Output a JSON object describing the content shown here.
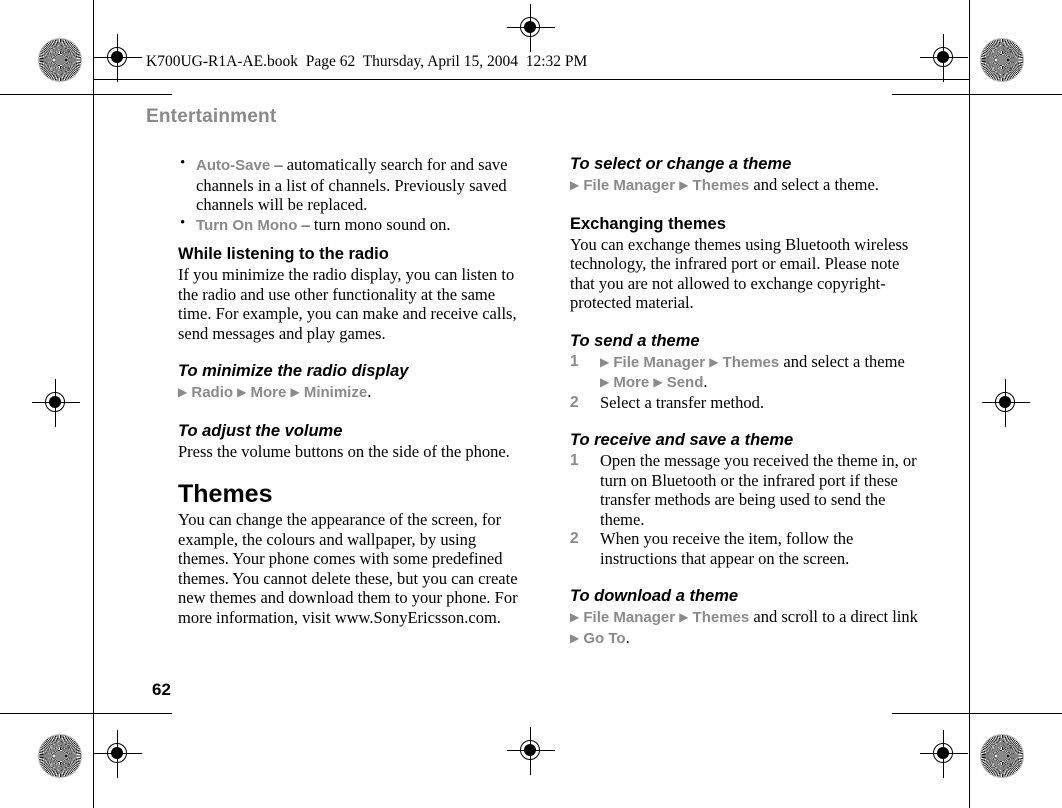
{
  "print_marks": {
    "file_header": "K700UG-R1A-AE.book  Page 62  Thursday, April 15, 2004  12:32 PM"
  },
  "page": {
    "running_head": "Entertainment",
    "page_number": "62",
    "arrow_glyph": "▶",
    "bullet_glyph": "•"
  },
  "left_column": {
    "bullets": [
      {
        "term": "Auto-Save",
        "dash": " – ",
        "text": "automatically search for and save channels in a list of channels. Previously saved channels will be replaced."
      },
      {
        "term": "Turn On Mono",
        "dash": " – ",
        "text": "turn mono sound on."
      }
    ],
    "section_listening": {
      "heading": "While listening to the radio",
      "body": "If you minimize the radio display, you can listen to the radio and use other functionality at the same time. For example, you can make and receive calls, send messages and play games."
    },
    "section_minimize": {
      "heading": "To minimize the radio display",
      "nav": [
        "Radio",
        "More",
        "Minimize"
      ],
      "nav_suffix": "."
    },
    "section_volume": {
      "heading": "To adjust the volume",
      "body": "Press the volume buttons on the side of the phone."
    },
    "section_themes": {
      "heading": "Themes",
      "body": "You can change the appearance of the screen, for example, the colours and wallpaper, by using themes. Your phone comes with some predefined themes. You cannot delete these, but you can create new themes and download them to your phone. For more information, visit www.SonyEricsson.com."
    }
  },
  "right_column": {
    "section_select_theme": {
      "heading": "To select or change a theme",
      "nav": [
        "File Manager",
        "Themes"
      ],
      "nav_suffix": " and select a theme."
    },
    "section_exchanging": {
      "heading": "Exchanging themes",
      "body": "You can exchange themes using Bluetooth wireless technology, the infrared port or email. Please note that you are not allowed to exchange copyright-protected material."
    },
    "section_send_theme": {
      "heading": "To send a theme",
      "steps": [
        {
          "num": "1",
          "nav_a": [
            "File Manager",
            "Themes"
          ],
          "mid_text": " and select a theme",
          "nav_b": [
            "More",
            "Send"
          ],
          "nav_b_suffix": "."
        },
        {
          "num": "2",
          "text": "Select a transfer method."
        }
      ]
    },
    "section_receive_theme": {
      "heading": "To receive and save a theme",
      "steps": [
        {
          "num": "1",
          "text": "Open the message you received the theme in, or turn on Bluetooth or the infrared port if these transfer methods are being used to send the theme."
        },
        {
          "num": "2",
          "text": "When you receive the item, follow the instructions that appear on the screen."
        }
      ]
    },
    "section_download_theme": {
      "heading": "To download a theme",
      "nav_a": [
        "File Manager",
        "Themes"
      ],
      "mid_text": " and scroll to a direct link",
      "nav_b": [
        "Go To"
      ],
      "nav_b_suffix": "."
    }
  },
  "colors": {
    "ui_term_gray": "#8a8a8a",
    "body_black": "#000000",
    "page_background": "#ffffff"
  }
}
